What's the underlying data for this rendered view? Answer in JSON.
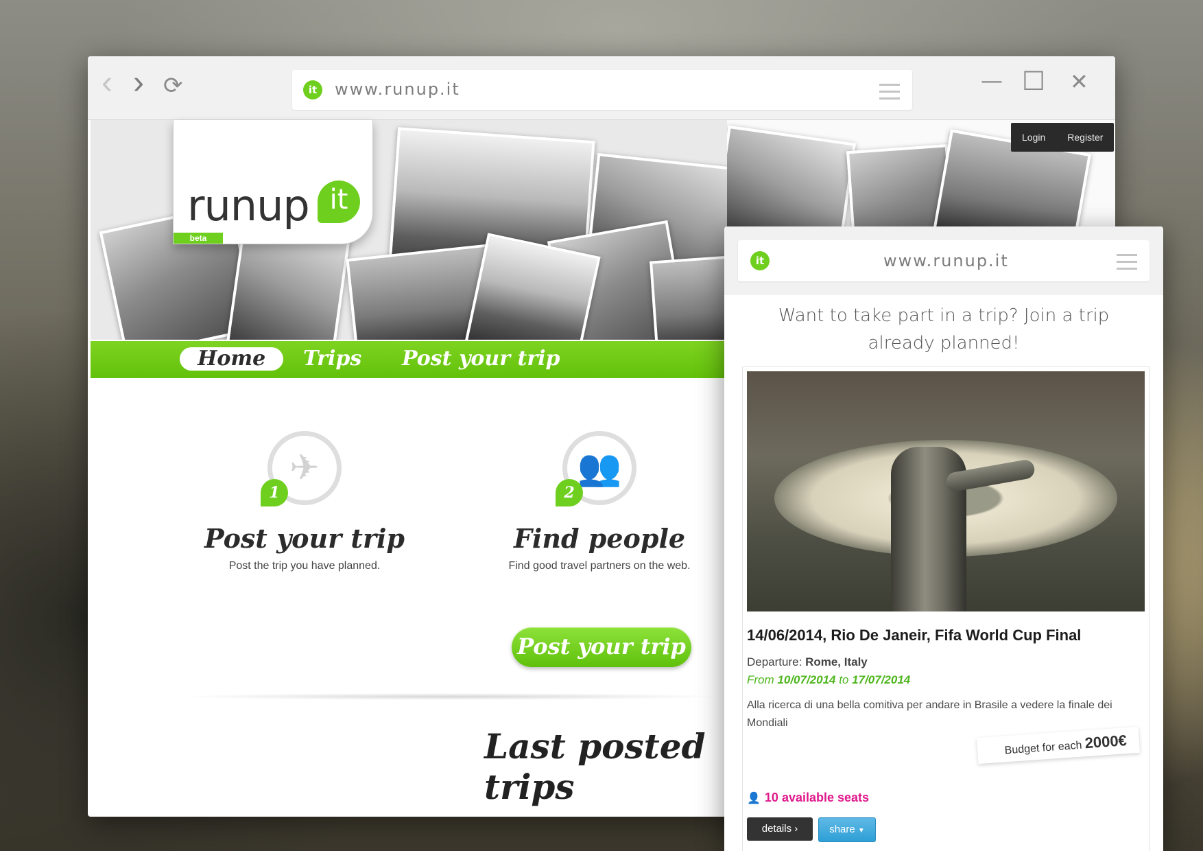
{
  "desktop": {
    "url": "www.runup.it",
    "nav_back": "‹",
    "nav_forward": "›",
    "nav_reload": "⟳",
    "win_min": "—",
    "win_max": "☐",
    "win_close": "✕",
    "favicon": "it",
    "logo": {
      "text": "runup",
      "badge": "it",
      "beta": "beta"
    },
    "auth": {
      "login": "Login",
      "register": "Register"
    },
    "nav": {
      "items": [
        "Home",
        "Trips",
        "Post your trip"
      ],
      "active": "Home"
    },
    "steps": [
      {
        "number": "1",
        "title": "Post your trip",
        "desc": "Post the trip you have planned.",
        "icon": "airplane-icon"
      },
      {
        "number": "2",
        "title": "Find people",
        "desc": "Find good travel partners on the web.",
        "icon": "people-icon"
      }
    ],
    "cta": "Post your trip",
    "section_title": "Last posted trips"
  },
  "mobile": {
    "url": "www.runup.it",
    "favicon": "it",
    "intro": "Want to take part in a trip? Join a trip already planned!",
    "trip": {
      "title": "14/06/2014, Rio De Janeir, Fifa World Cup Final",
      "departure_label": "Departure:",
      "departure": "Rome, Italy",
      "from_label": "From",
      "from_date": "10/07/2014",
      "to_label": "to",
      "to_date": "17/07/2014",
      "description": "Alla ricerca di una bella comitiva per andare in Brasile a vedere la finale dei Mondiali",
      "budget_label": "Budget for each",
      "budget_amount": "2000€",
      "seats": "10 available seats",
      "details_button": "details",
      "share_button": "share"
    }
  },
  "colors": {
    "brand_green": "#6fcf1f",
    "seats_pink": "#e0188c",
    "share_blue": "#2e9fd6",
    "dark": "#2a2a2a"
  }
}
